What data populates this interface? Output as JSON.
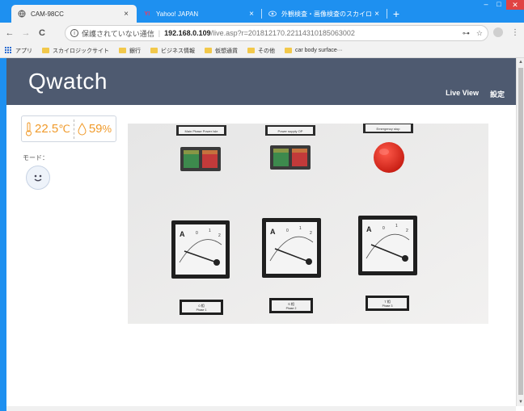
{
  "browser": {
    "tabs": [
      {
        "title": "CAM-98CC",
        "active": true,
        "icon": "globe-icon"
      },
      {
        "title": "Yahoo! JAPAN",
        "active": false,
        "icon": "yahoo-icon",
        "favicon_text": "Y!"
      },
      {
        "title": "外観検査・画像検査のスカイロジック",
        "active": false,
        "icon": "site-icon"
      }
    ],
    "new_tab_label": "+",
    "close_glyph": "×",
    "window_controls": {
      "min": "–",
      "max": "□",
      "close": "✕"
    },
    "nav": {
      "back": "←",
      "forward": "→",
      "reload": "C"
    },
    "omnibox": {
      "security_icon": "info-icon",
      "security_glyph": "i",
      "security_text": "保護されていない通信",
      "separator": "|",
      "host": "192.168.0.109",
      "path": "/live.asp?r=201812170.22114310185063002",
      "key_glyph": "⊶",
      "star_glyph": "☆"
    },
    "menu_glyph": "⋮",
    "bookmarks": [
      {
        "label": "アプリ",
        "icon": "apps-icon"
      },
      {
        "label": "スカイロジックサイト",
        "icon": "folder-icon"
      },
      {
        "label": "銀行",
        "icon": "folder-icon"
      },
      {
        "label": "ビジネス情報",
        "icon": "folder-icon"
      },
      {
        "label": "仮想通貨",
        "icon": "folder-icon"
      },
      {
        "label": "その他",
        "icon": "folder-icon"
      },
      {
        "label": "car body surface···",
        "icon": "folder-icon"
      }
    ]
  },
  "page": {
    "brand": "Qwatch",
    "nav_links": [
      "Live View",
      "設定"
    ],
    "sensor": {
      "temperature": "22.5",
      "temperature_unit": "℃",
      "humidity": "59",
      "humidity_unit": "%"
    },
    "mode_label": "モード：",
    "colors": {
      "header_bg": "#4e5a70",
      "sensor_text": "#f09a2a",
      "browser_accent": "#1e90f0"
    },
    "camera": {
      "panel_labels": [
        "Main Phase Power Isle",
        "Power supply OP",
        "Emergency stop"
      ],
      "meter_letter": "A",
      "meter_scale": [
        "0",
        "1",
        "2"
      ],
      "phase_labels": [
        {
          "top": "0 相",
          "bottom": "Phase 1"
        },
        {
          "top": "S 相",
          "bottom": "Phase 2"
        },
        {
          "top": "T 相",
          "bottom": "Phase 3"
        }
      ]
    }
  }
}
